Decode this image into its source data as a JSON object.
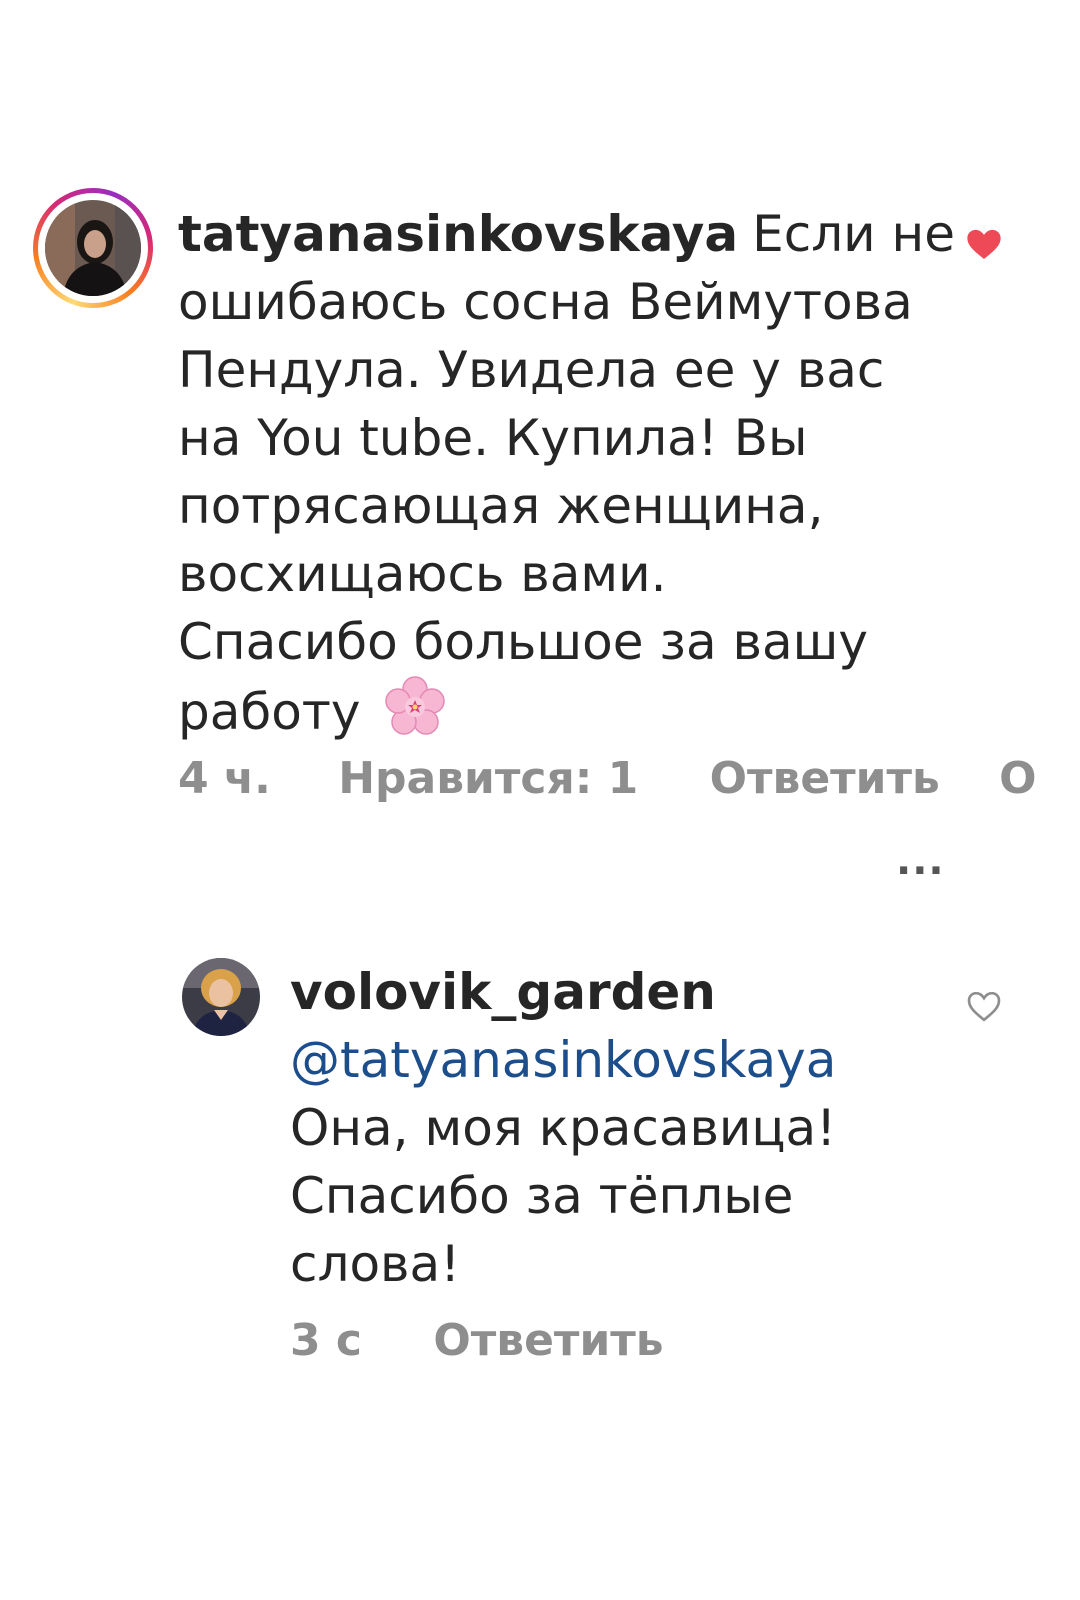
{
  "comments": [
    {
      "username": "tatyanasinkovskaya",
      "text_lines": [
        "Если не",
        "ошибаюсь сосна Веймутова",
        "Пендула. Увидела ее у вас",
        "на You tube. Купила! Вы",
        "потрясающая женщина,",
        "восхищаюсь вами.",
        "Спасибо большое за вашу",
        "работу"
      ],
      "emoji": "🌸",
      "time": "4 ч.",
      "likes": "Нравится: 1",
      "reply_label": "Ответить",
      "extra": "О",
      "liked": true,
      "like_icon": "heart-filled-icon",
      "like_color": "#ed4956",
      "has_story_ring": true
    },
    {
      "username": "volovik_garden",
      "mention": "@tatyanasinkovskaya",
      "text_lines": [
        "Она, моя красавица!",
        "Спасибо за тёплые",
        "слова!"
      ],
      "time": "3 с",
      "reply_label": "Ответить",
      "liked": false,
      "like_icon": "heart-outline-icon",
      "has_story_ring": false
    }
  ],
  "more_label": "...",
  "colors": {
    "mention": "#1c4e8c",
    "meta": "#8e8e8e",
    "text": "#262626"
  }
}
